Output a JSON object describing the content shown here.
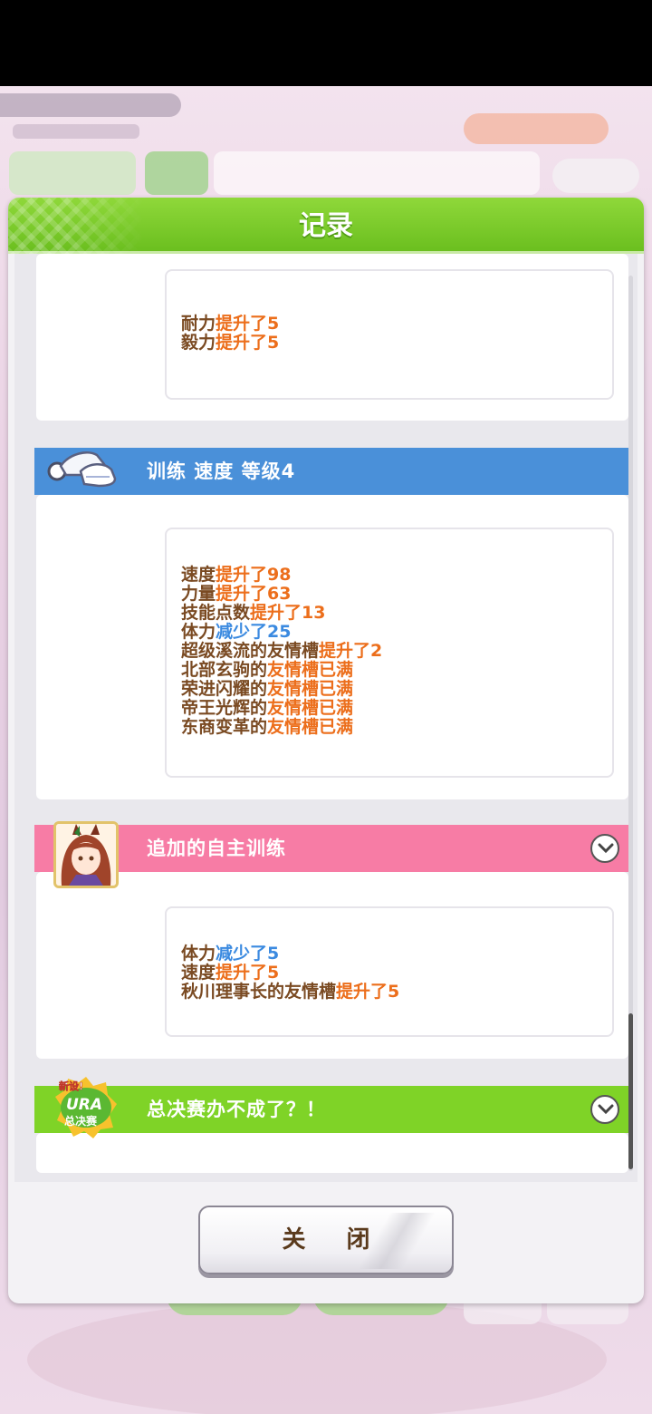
{
  "dialog": {
    "title": "记录",
    "close_label": "关 闭"
  },
  "entries": [
    {
      "header": "",
      "lines": [
        [
          {
            "t": "耐力",
            "c": "brown"
          },
          {
            "t": "提升了5",
            "c": "orange"
          }
        ],
        [
          {
            "t": "毅力",
            "c": "brown"
          },
          {
            "t": "提升了5",
            "c": "orange"
          }
        ]
      ]
    },
    {
      "header": "训练 速度 等级4",
      "header_color": "#4a90d9",
      "icon": "running-shoes-icon",
      "lines": [
        [
          {
            "t": "速度",
            "c": "brown"
          },
          {
            "t": "提升了98",
            "c": "orange"
          }
        ],
        [
          {
            "t": "力量",
            "c": "brown"
          },
          {
            "t": "提升了63",
            "c": "orange"
          }
        ],
        [
          {
            "t": "技能点数",
            "c": "brown"
          },
          {
            "t": "提升了13",
            "c": "orange"
          }
        ],
        [
          {
            "t": "体力",
            "c": "brown"
          },
          {
            "t": "减少了25",
            "c": "blue"
          }
        ],
        [
          {
            "t": "超级溪流的友情槽",
            "c": "brown"
          },
          {
            "t": "提升了2",
            "c": "orange"
          }
        ],
        [
          {
            "t": "北部玄驹的",
            "c": "brown"
          },
          {
            "t": "友情槽已满",
            "c": "orange"
          }
        ],
        [
          {
            "t": "荣进闪耀的",
            "c": "brown"
          },
          {
            "t": "友情槽已满",
            "c": "orange"
          }
        ],
        [
          {
            "t": "帝王光辉的",
            "c": "brown"
          },
          {
            "t": "友情槽已满",
            "c": "orange"
          }
        ],
        [
          {
            "t": "东商变革的",
            "c": "brown"
          },
          {
            "t": "友情槽已满",
            "c": "orange"
          }
        ]
      ]
    },
    {
      "header": "追加的自主训练",
      "header_color": "#f77ca5",
      "icon": "character-portrait-icon",
      "lines": [
        [
          {
            "t": "体力",
            "c": "brown"
          },
          {
            "t": "减少了5",
            "c": "blue"
          }
        ],
        [
          {
            "t": "速度",
            "c": "brown"
          },
          {
            "t": "提升了5",
            "c": "orange"
          }
        ],
        [
          {
            "t": "秋川理事长的友情槽",
            "c": "brown"
          },
          {
            "t": "提升了5",
            "c": "orange"
          }
        ]
      ]
    },
    {
      "header": "总决赛办不成了？！",
      "header_color": "#7fd327",
      "icon": "ura-finals-icon",
      "icon_text": [
        "新设!",
        "URA",
        "总决赛"
      ],
      "lines": []
    }
  ],
  "colors": {
    "brown": "#7a4a22",
    "orange": "#ec6e1b",
    "blue": "#3b8ae0",
    "title_green": "#6bbf1f"
  }
}
